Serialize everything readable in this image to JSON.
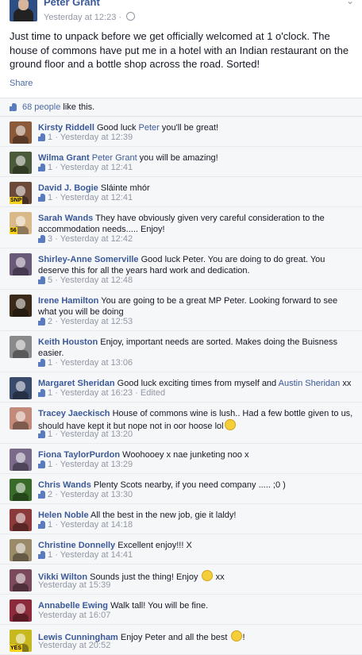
{
  "post": {
    "author": "Peter Grant",
    "timestamp": "Yesterday at 12:23",
    "text": "Just time to unpack before we get officially welcomed at 1 o'clock. The house of commons have put me in a hotel with an Indian restaurant on the ground floor and a bottle shop across the road. Sorted!",
    "share_label": "Share"
  },
  "likes": {
    "count_link": "68 people",
    "suffix": " like this."
  },
  "comments": [
    {
      "name": "Kirsty Riddell",
      "text_before": " Good luck ",
      "mention": "Peter",
      "text_after": " you'll be great!",
      "likes": "1",
      "time": "Yesterday at 12:39",
      "avatar_color": "#8a5a3b"
    },
    {
      "name": "Wilma Grant",
      "text_before": " ",
      "mention": "Peter Grant",
      "text_after": " you will be amazing!",
      "likes": "1",
      "time": "Yesterday at 12:41",
      "avatar_color": "#4a5a3a"
    },
    {
      "name": "David J. Bogie",
      "text_before": " Sláinte mhór",
      "mention": "",
      "text_after": "",
      "likes": "1",
      "time": "Yesterday at 12:41",
      "avatar_color": "#6b4a3a",
      "badge": "SNP"
    },
    {
      "name": "Sarah Wands",
      "text_before": " They have obviously given very careful consideration to the accommodation needs..... Enjoy!",
      "mention": "",
      "text_after": "",
      "likes": "3",
      "time": "Yesterday at 12:42",
      "avatar_color": "#d9b98a",
      "badge": "56"
    },
    {
      "name": "Shirley-Anne Somerville",
      "text_before": " Good luck Peter. You are doing to do great. You deserve this for all the years hard work and dedication.",
      "mention": "",
      "text_after": "",
      "likes": "5",
      "time": "Yesterday at 12:48",
      "avatar_color": "#6a5a7a"
    },
    {
      "name": "Irene Hamilton",
      "text_before": " You are going to be a great MP Peter. Looking forward to see what you will be doing",
      "mention": "",
      "text_after": "",
      "likes": "2",
      "time": "Yesterday at 12:53",
      "avatar_color": "#3a2a1a"
    },
    {
      "name": "Keith Houston",
      "text_before": " Enjoy, important needs are sorted. Makes doing the Buisness easier.",
      "mention": "",
      "text_after": "",
      "likes": "1",
      "time": "Yesterday at 13:06",
      "avatar_color": "#8a8a8a"
    },
    {
      "name": "Margaret Sheridan",
      "text_before": " Good luck exciting times from myself and ",
      "mention": "Austin Sheridan",
      "text_after": " xx",
      "likes": "1",
      "time": "Yesterday at 16:23 · Edited",
      "avatar_color": "#3a4a6a"
    },
    {
      "name": "Tracey Jaeckisch",
      "text_before": " House of commons wine is lush.. Had a few bottle given to us, should have kept it but nope not in oor hoose lol",
      "mention": "",
      "text_after": "",
      "emoji": true,
      "likes": "1",
      "time": "Yesterday at 13:20",
      "avatar_color": "#c28a7a"
    },
    {
      "name": "Fiona TaylorPurdon",
      "text_before": " Woohooey x nae junketing noo x",
      "mention": "",
      "text_after": "",
      "likes": "1",
      "time": "Yesterday at 13:29",
      "avatar_color": "#7a6a8a"
    },
    {
      "name": "Chris Wands",
      "text_before": " Plenty Scots nearby, if you need company ..... ;0 )",
      "mention": "",
      "text_after": "",
      "likes": "2",
      "time": "Yesterday at 13:30",
      "avatar_color": "#3a6a2a"
    },
    {
      "name": "Helen Noble",
      "text_before": " All the best in the new job, gie it laldy!",
      "mention": "",
      "text_after": "",
      "likes": "1",
      "time": "Yesterday at 14:18",
      "avatar_color": "#8a3a3a"
    },
    {
      "name": "Christine Donnelly",
      "text_before": " Excellent enjoy!!! X",
      "mention": "",
      "text_after": "",
      "likes": "1",
      "time": "Yesterday at 14:41",
      "avatar_color": "#9a8a6a"
    },
    {
      "name": "Vikki Wilton",
      "text_before": " Sounds just the thing! Enjoy ",
      "mention": "",
      "text_after": " xx",
      "emoji": true,
      "likes": "",
      "time": "Yesterday at 15:39",
      "avatar_color": "#7a4a5a"
    },
    {
      "name": "Annabelle Ewing",
      "text_before": " Walk tall! You will be fine.",
      "mention": "",
      "text_after": "",
      "likes": "",
      "time": "Yesterday at 16:07",
      "avatar_color": "#8a2a3a"
    },
    {
      "name": "Lewis Cunningham",
      "text_before": " Enjoy Peter and all the best ",
      "mention": "",
      "text_after": "!",
      "emoji": true,
      "likes": "",
      "time": "Yesterday at 20:52",
      "avatar_color": "#c8b820",
      "badge": "YES"
    }
  ]
}
